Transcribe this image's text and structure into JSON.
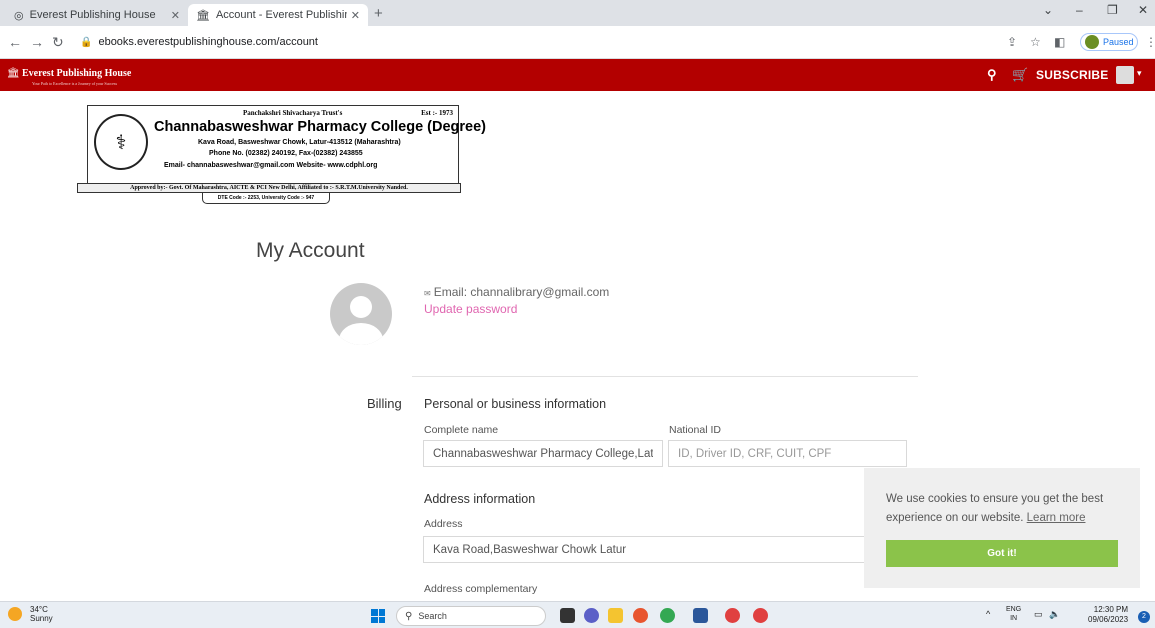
{
  "browser": {
    "tabs": [
      {
        "label": "Everest Publishing House",
        "active": false
      },
      {
        "label": "Account - Everest Publishing Hou",
        "active": true
      }
    ],
    "url": "ebooks.everestpublishinghouse.com/account",
    "profile_status": "Paused"
  },
  "site": {
    "brand": "Everest Publishing House",
    "brand_tagline": "Your Path to Excellence is a Journey of your Success",
    "subscribe_label": "SUBSCRIBE",
    "accent_color": "#b30000"
  },
  "college": {
    "trust": "Panchakshri Shivacharya Trust's",
    "est": "Est :- 1973",
    "name": "Channabasweshwar Pharmacy College (Degree)",
    "address": "Kava Road, Basweshwar Chowk, Latur-413512 (Maharashtra)",
    "phone": "Phone No. (02382) 240192, Fax-(02382) 243855",
    "contact": "Email- channabasweshwar@gmail.com Website- www.cdphl.org",
    "approved": "Approved by:- Govt. Of Maharashtra, AICTE & PCI New Delhi, Affiliated to :- S.R.T.M.University Nanded.",
    "codes": "DTE Code :- 2253, University Code :- 947"
  },
  "account": {
    "title": "My Account",
    "email_text": "Email: channalibrary@gmail.com",
    "update_password": "Update password",
    "billing_label": "Billing",
    "personal_section": "Personal or business information",
    "complete_name_label": "Complete name",
    "complete_name_value": "Channabasweshwar Pharmacy College,Latur",
    "national_id_label": "National ID",
    "national_id_placeholder": "ID, Driver ID, CRF, CUIT, CPF",
    "address_section": "Address information",
    "address_label": "Address",
    "address_value": "Kava Road,Basweshwar Chowk Latur",
    "address_comp_label": "Address complementary"
  },
  "cookie": {
    "message": "We use cookies to ensure you get the best experience on our website.",
    "learn_more": "Learn more",
    "button": "Got it!"
  },
  "taskbar": {
    "temperature": "34°C",
    "weather": "Sunny",
    "search_label": "Search",
    "lang1": "ENG",
    "lang2": "IN",
    "time": "12:30 PM",
    "date": "09/06/2023",
    "notifications": "2"
  }
}
